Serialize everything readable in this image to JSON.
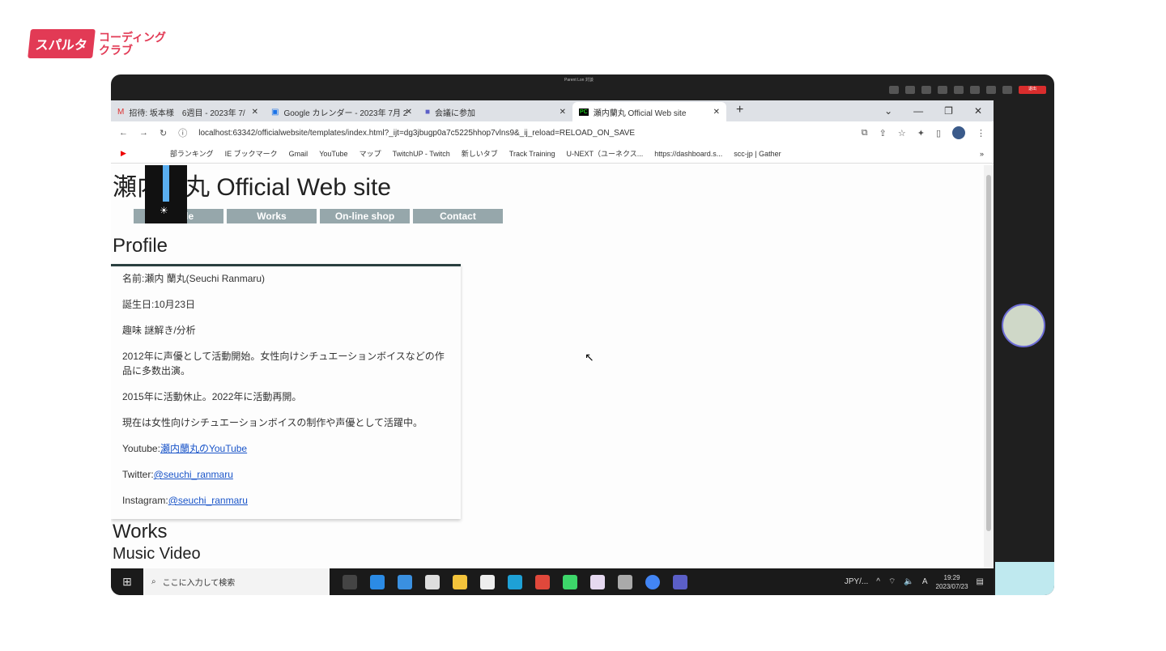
{
  "logo": {
    "badge": "スパルタ",
    "text1": "コーディング",
    "text2": "クラブ"
  },
  "meeting": {
    "title": "Parent Lon 対談",
    "leave": "退出"
  },
  "tabs": [
    {
      "label": "招待: 坂本様　6週目 - 2023年 7/",
      "icon": "gmail-icon"
    },
    {
      "label": "Google カレンダー - 2023年 7月 2",
      "icon": "calendar-icon"
    },
    {
      "label": "会議に参加",
      "icon": "teams-icon"
    },
    {
      "label": "瀬内蘭丸 Official Web site",
      "icon": "pycharm-icon"
    }
  ],
  "address": {
    "url": "localhost:63342/officialwebsite/templates/index.html?_ijt=dg3jbugp0a7c5225hhop7vlns9&_ij_reload=RELOAD_ON_SAVE"
  },
  "bookmarks": [
    "部ランキング",
    "IE ブックマーク",
    "Gmail",
    "YouTube",
    "マップ",
    "TwitchUP - Twitch",
    "新しいタブ",
    "Track Training",
    "U-NEXT（ユーネクス...",
    "https://dashboard.s...",
    "scc-jp | Gather"
  ],
  "site": {
    "title": "瀬内蘭丸 Official Web site",
    "nav": [
      "Profile",
      "Works",
      "On-line shop",
      "Contact"
    ],
    "profile_heading": "Profile",
    "profile": {
      "name": "名前:瀬内 蘭丸(Seuchi Ranmaru)",
      "birthday": "誕生日:10月23日",
      "hobby": "趣味 謎解き/分析",
      "bio1": "2012年に声優として活動開始。女性向けシチュエーションボイスなどの作品に多数出演。",
      "bio2": "2015年に活動休止。2022年に活動再開。",
      "bio3": "現在は女性向けシチュエーションボイスの制作や声優として活躍中。",
      "youtube_label": "Youtube:",
      "youtube_link": "瀬内蘭丸のYouTube",
      "twitter_label": "Twitter:",
      "twitter_link": "@seuchi_ranmaru",
      "instagram_label": "Instagram:",
      "instagram_link": "@seuchi_ranmaru"
    },
    "works_heading": "Works",
    "music_heading": "Music Video"
  },
  "taskbar": {
    "search_placeholder": "ここに入力して検索",
    "currency": "JPY/...",
    "time": "19:29",
    "date": "2023/07/23",
    "ime": "A"
  }
}
